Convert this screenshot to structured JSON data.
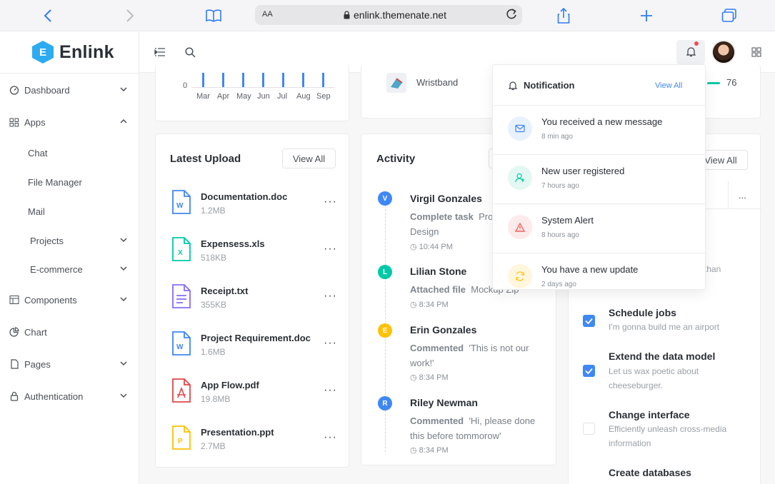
{
  "browser": {
    "text_size": "AA",
    "url": "enlink.themenate.net"
  },
  "logo": {
    "letter": "E",
    "name": "Enlink"
  },
  "sidebar": {
    "items": [
      {
        "label": "Dashboard",
        "icon": "dashboard-icon"
      },
      {
        "label": "Apps",
        "icon": "apps-icon"
      },
      {
        "label": "Chat"
      },
      {
        "label": "File Manager"
      },
      {
        "label": "Mail"
      },
      {
        "label": "Projects"
      },
      {
        "label": "E-commerce"
      },
      {
        "label": "Components",
        "icon": "components-icon"
      },
      {
        "label": "Chart",
        "icon": "chart-icon"
      },
      {
        "label": "Pages",
        "icon": "pages-icon"
      },
      {
        "label": "Authentication",
        "icon": "lock-icon"
      }
    ]
  },
  "mini_chart": {
    "y_tick": "0",
    "months": [
      "Mar",
      "Apr",
      "May",
      "Jun",
      "Jul",
      "Aug",
      "Sep"
    ]
  },
  "product": {
    "name": "Wristband",
    "value": "76"
  },
  "latest_upload": {
    "title": "Latest Upload",
    "view_all": "View All",
    "files": [
      {
        "name": "Documentation.doc",
        "size": "1.2MB",
        "type": "word"
      },
      {
        "name": "Expensess.xls",
        "size": "518KB",
        "type": "excel"
      },
      {
        "name": "Receipt.txt",
        "size": "355KB",
        "type": "text"
      },
      {
        "name": "Project Requirement.doc",
        "size": "1.6MB",
        "type": "word"
      },
      {
        "name": "App Flow.pdf",
        "size": "19.8MB",
        "type": "pdf"
      },
      {
        "name": "Presentation.ppt",
        "size": "2.7MB",
        "type": "ppt"
      }
    ]
  },
  "activity": {
    "title": "Activity",
    "items": [
      {
        "initial": "V",
        "name": "Virgil Gonzales",
        "action": "Complete task",
        "detail": "Prototype Design",
        "detail_shown": "Prot",
        "detail_line2": "Design",
        "time": "10:44 PM",
        "color": "#3f87f5"
      },
      {
        "initial": "L",
        "name": "Lilian Stone",
        "action": "Attached file",
        "detail": "Mockup Zip",
        "time": "8:34 PM",
        "color": "#00c9a7"
      },
      {
        "initial": "E",
        "name": "Erin Gonzales",
        "action": "Commented",
        "detail": "'This is not our",
        "detail_line2": "work!'",
        "time": "8:34 PM",
        "color": "#ffc107"
      },
      {
        "initial": "R",
        "name": "Riley Newman",
        "action": "Commented",
        "detail": "'Hi, please done",
        "detail_line2": "this before tommorow'",
        "time": "8:34 PM",
        "color": "#3f87f5"
      }
    ]
  },
  "tasks": {
    "view_all": "View All",
    "more": "...",
    "partial_text": "than",
    "items": [
      {
        "title": "Schedule jobs",
        "desc": "I'm gonna build me an airport",
        "checked": true
      },
      {
        "title": "Extend the data model",
        "desc": "Let us wax poetic about cheeseburger.",
        "checked": true
      },
      {
        "title": "Change interface",
        "desc": "Efficiently unleash cross-media information",
        "checked": false
      },
      {
        "title": "Create databases",
        "desc": "",
        "checked": false
      }
    ]
  },
  "notifications": {
    "title": "Notification",
    "view_all": "View All",
    "items": [
      {
        "text": "You received a new message",
        "time": "8 min ago",
        "icon": "mail-icon",
        "bg": "#e8f1fe",
        "fg": "#3f87f5"
      },
      {
        "text": "New user registered",
        "time": "7 hours ago",
        "icon": "user-add-icon",
        "bg": "#e3f8f3",
        "fg": "#00c9a7"
      },
      {
        "text": "System Alert",
        "time": "8 hours ago",
        "icon": "warning-icon",
        "bg": "#fdeaea",
        "fg": "#ef4c4c"
      },
      {
        "text": "You have a new update",
        "time": "2 days ago",
        "icon": "sync-icon",
        "bg": "#fff6dd",
        "fg": "#ffc107"
      }
    ]
  },
  "colors": {
    "accent": "#3f87f5",
    "brand": "#2dabf1"
  }
}
